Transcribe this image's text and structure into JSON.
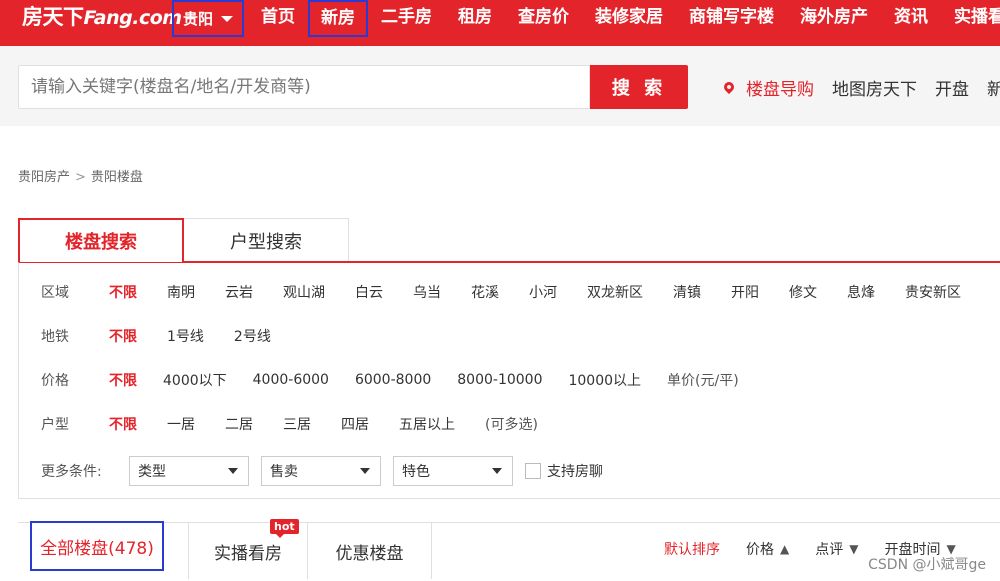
{
  "header": {
    "logo": {
      "cn": "房天下",
      "en": "Fang.com"
    },
    "city": "贵阳",
    "nav": [
      "首页",
      "新房",
      "二手房",
      "租房",
      "查房价",
      "装修家居",
      "商铺写字楼",
      "海外房产",
      "资讯",
      "实播看"
    ]
  },
  "search": {
    "placeholder": "请输入关键字(楼盘名/地名/开发商等)",
    "button": "搜 索",
    "quick_links": [
      "楼盘导购",
      "地图房天下",
      "开盘",
      "新"
    ]
  },
  "breadcrumb": [
    "贵阳房产",
    ">",
    "贵阳楼盘"
  ],
  "search_tabs": [
    "楼盘搜索",
    "户型搜索"
  ],
  "filters": {
    "area": {
      "label": "区域",
      "options": [
        "不限",
        "南明",
        "云岩",
        "观山湖",
        "白云",
        "乌当",
        "花溪",
        "小河",
        "双龙新区",
        "清镇",
        "开阳",
        "修文",
        "息烽",
        "贵安新区"
      ]
    },
    "subway": {
      "label": "地铁",
      "options": [
        "不限",
        "1号线",
        "2号线"
      ]
    },
    "price": {
      "label": "价格",
      "options": [
        "不限",
        "4000以下",
        "4000-6000",
        "6000-8000",
        "8000-10000",
        "10000以上"
      ],
      "note": "单价(元/平)"
    },
    "layout": {
      "label": "户型",
      "options": [
        "不限",
        "一居",
        "二居",
        "三居",
        "四居",
        "五居以上"
      ],
      "note": "(可多选)"
    },
    "more": {
      "label": "更多条件:",
      "selects": [
        "类型",
        "售卖",
        "特色"
      ],
      "checkbox": "支持房聊"
    }
  },
  "listing_tabs": {
    "all": "全部楼盘(478)",
    "live": "实播看房",
    "hot": "hot",
    "discount": "优惠楼盘"
  },
  "sorts": [
    "默认排序",
    "价格",
    "点评",
    "开盘时间"
  ],
  "watermark": "CSDN @小斌哥ge",
  "colors": {
    "brand": "#e4242b",
    "highlight_box": "#2b3bd1"
  }
}
